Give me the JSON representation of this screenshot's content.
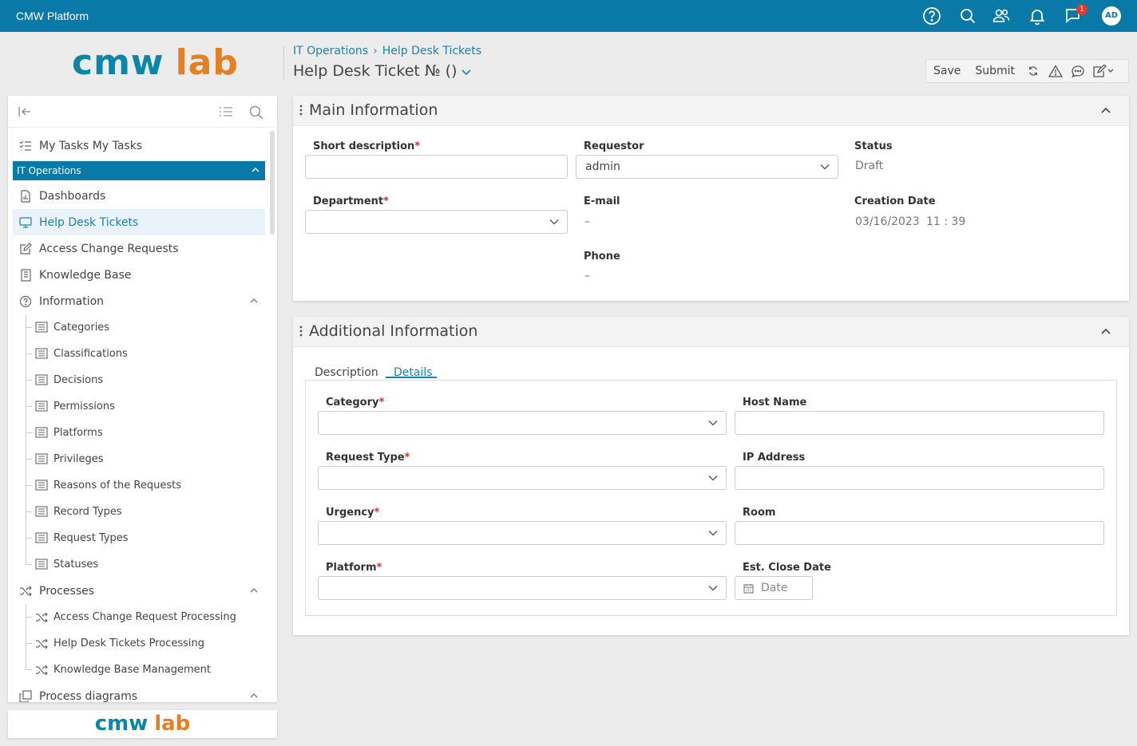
{
  "topbar": {
    "app_title": "CMW Platform",
    "icons": [
      "help-icon",
      "search-icon",
      "users-icon",
      "bell-icon",
      "chat-icon"
    ],
    "notification_count": "1",
    "avatar_initials": "AD",
    "background": "#0979a8"
  },
  "brand": {
    "logo_part1": "cmw",
    "logo_part2": "lab",
    "color1": "#0a86a8",
    "color2": "#e67e22"
  },
  "breadcrumb": {
    "items": [
      "IT Operations",
      "Help Desk Tickets"
    ]
  },
  "page": {
    "title": "Help Desk Ticket № ()"
  },
  "toolbar": {
    "save_label": "Save",
    "submit_label": "Submit",
    "icons": [
      "refresh-icon",
      "warning-icon",
      "comment-icon",
      "edit-icon"
    ]
  },
  "sidebar": {
    "top_item": "My Tasks My Tasks",
    "group_label": "IT Operations",
    "items": [
      {
        "label": "Dashboards",
        "icon": "dashboard-icon"
      },
      {
        "label": "Help Desk Tickets",
        "icon": "monitor-icon"
      },
      {
        "label": "Access Change Requests",
        "icon": "edit-icon"
      },
      {
        "label": "Knowledge Base",
        "icon": "book-icon"
      },
      {
        "label": "Information",
        "icon": "question-icon"
      }
    ],
    "information_items": [
      "Categories",
      "Classifications",
      "Decisions",
      "Permissions",
      "Platforms",
      "Privileges",
      "Reasons of the Requests",
      "Record Types",
      "Request Types",
      "Statuses"
    ],
    "processes_label": "Processes",
    "process_items": [
      "Access Change Request Processing",
      "Help Desk Tickets Processing",
      "Knowledge Base Management"
    ],
    "process_diagrams_label": "Process diagrams"
  },
  "main_info": {
    "title": "Main Information",
    "short_description_label": "Short description",
    "short_description_value": "",
    "requestor_label": "Requestor",
    "requestor_value": "admin",
    "status_label": "Status",
    "status_value": "Draft",
    "department_label": "Department",
    "department_value": "",
    "email_label": "E-mail",
    "email_value": "–",
    "creation_date_label": "Creation Date",
    "creation_date_value": "03/16/2023",
    "creation_time_value": "11 : 39",
    "phone_label": "Phone",
    "phone_value": "–"
  },
  "additional_info": {
    "title": "Additional Information",
    "tabs": [
      "Description",
      "Details"
    ],
    "active_tab": "Details",
    "category_label": "Category",
    "host_name_label": "Host Name",
    "request_type_label": "Request Type",
    "ip_address_label": "IP Address",
    "urgency_label": "Urgency",
    "room_label": "Room",
    "platform_label": "Platform",
    "est_close_date_label": "Est. Close Date",
    "est_close_date_placeholder": "Date"
  },
  "required_marker": "*"
}
